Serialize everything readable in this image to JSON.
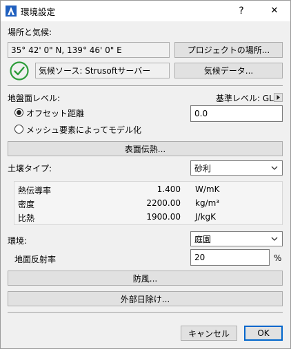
{
  "window": {
    "title": "環境設定",
    "help": "?",
    "close": "✕"
  },
  "location": {
    "heading": "場所と気候:",
    "coords": "35° 42' 0\" N, 139° 46' 0\" E",
    "project_location_btn": "プロジェクトの場所...",
    "climate_source": "気候ソース: Strusoftサーバー",
    "climate_data_btn": "気候データ..."
  },
  "ground": {
    "heading": "地盤面レベル:",
    "ref_level": "基準レベル: GL",
    "opt_offset": "オフセット距離",
    "opt_mesh": "メッシュ要素によってモデル化",
    "offset_value": "0.0",
    "surface_heat_btn": "表面伝熱..."
  },
  "soil": {
    "heading": "土壌タイプ:",
    "selected": "砂利",
    "rows": [
      {
        "name": "熱伝導率",
        "value": "1.400",
        "unit": "W/mK"
      },
      {
        "name": "密度",
        "value": "2200.00",
        "unit": "kg/m³"
      },
      {
        "name": "比熱",
        "value": "1900.00",
        "unit": "J/kgK"
      }
    ]
  },
  "environment": {
    "heading": "環境:",
    "selected": "庭園",
    "albedo_label": "地面反射率",
    "albedo_value": "20",
    "albedo_unit": "%",
    "windbreak_btn": "防風...",
    "shading_btn": "外部日除け..."
  },
  "footer": {
    "cancel": "キャンセル",
    "ok": "OK"
  },
  "colors": {
    "check_green": "#2e9d3b",
    "accent_blue": "#0066cc"
  }
}
